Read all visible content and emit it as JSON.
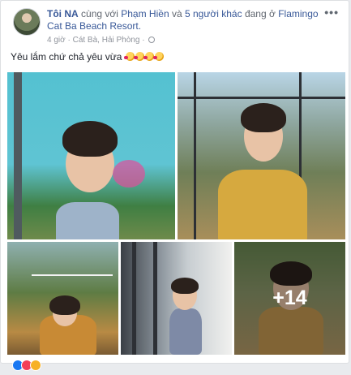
{
  "post": {
    "author": "Tôi NA",
    "with_text": "cùng với",
    "tagged": "Phạm Hiền",
    "and_text": "và",
    "others": "5 người khác",
    "at_text": "đang ở",
    "place": "Flamingo Cat Ba Beach Resort.",
    "time": "4 giờ",
    "separator": "·",
    "location": "Cát Bà, Hải Phòng",
    "caption": "Yêu lắm chứ chả yêu vừa",
    "caption_emoji_count": 4,
    "more_label": "•••",
    "more_photos": "+14",
    "reaction_colors": [
      "#1877f2",
      "#f33e58",
      "#f7b125"
    ],
    "icons": [
      "more-options-icon",
      "globe-icon",
      "heart-face-emoji-icon"
    ]
  }
}
